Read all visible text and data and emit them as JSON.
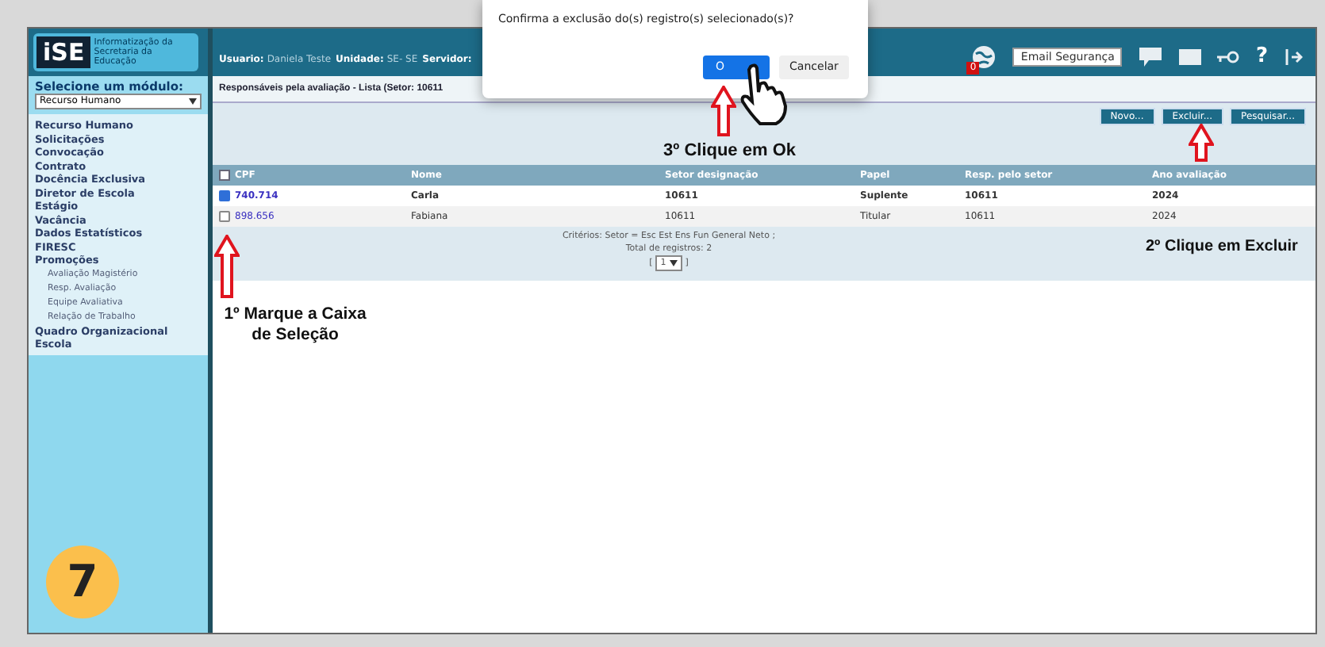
{
  "step_badge": "7",
  "logo": {
    "mark": "iSE",
    "subtitle": "Informatização da Secretaria da Educação"
  },
  "module_select": {
    "label": "Selecione um módulo:",
    "value": "Recurso Humano"
  },
  "sidebar": {
    "items": [
      {
        "label": "Recurso Humano"
      },
      {
        "label": "Solicitações"
      },
      {
        "label": "Convocação"
      },
      {
        "label": "Contrato"
      },
      {
        "label": "Docência Exclusiva"
      },
      {
        "label": "Diretor de Escola"
      },
      {
        "label": "Estágio"
      },
      {
        "label": "Vacância"
      },
      {
        "label": "Dados Estatísticos"
      },
      {
        "label": "FIRESC"
      },
      {
        "label": "Promoções",
        "children": [
          {
            "label": "Avaliação Magistério"
          },
          {
            "label": "Resp. Avaliação"
          },
          {
            "label": "Equipe Avaliativa"
          },
          {
            "label": "Relação de Trabalho"
          }
        ]
      },
      {
        "label": "Quadro Organizacional Escola"
      }
    ]
  },
  "user_bar": [
    {
      "label": "Usuario:",
      "value": "Daniela Teste"
    },
    {
      "label": "Unidade:",
      "value": "SE- SE"
    },
    {
      "label": "Servidor:"
    }
  ],
  "top_icons": {
    "notification_count": "0",
    "email_button": "Email Segurança",
    "help": "?"
  },
  "page_title": "Responsáveis pela avaliação - Lista (Setor: 10611",
  "actions": [
    "Novo...",
    "Excluir...",
    "Pesquisar..."
  ],
  "table": {
    "columns": [
      "CPF",
      "Nome",
      "Setor designação",
      "Papel",
      "Resp. pelo setor",
      "Ano avaliação"
    ],
    "all_checked": false,
    "rows": [
      {
        "checked": true,
        "cells": [
          "740.714",
          "Carla",
          "10611",
          "Suplente",
          "10611",
          "2024"
        ]
      },
      {
        "checked": false,
        "cells": [
          "898.656",
          "Fabiana",
          "10611",
          "Titular",
          "10611",
          "2024"
        ]
      }
    ]
  },
  "criteria": "Critérios: Setor = Esc Est Ens Fun General Neto ;",
  "total": "Total de registros: 2",
  "pager": {
    "open": "[",
    "value": "1",
    "close": "]"
  },
  "dialog": {
    "message": "Confirma a exclusão do(s) registro(s) selecionado(s)?",
    "ok": "O",
    "cancel": "Cancelar"
  },
  "annotations": [
    {
      "kind": "checkbox",
      "text": "1º Marque a Caixa de Seleção"
    },
    {
      "kind": "delete",
      "text": "2º Clique em Excluir"
    },
    {
      "kind": "ok",
      "text": "3º Clique em Ok"
    }
  ]
}
